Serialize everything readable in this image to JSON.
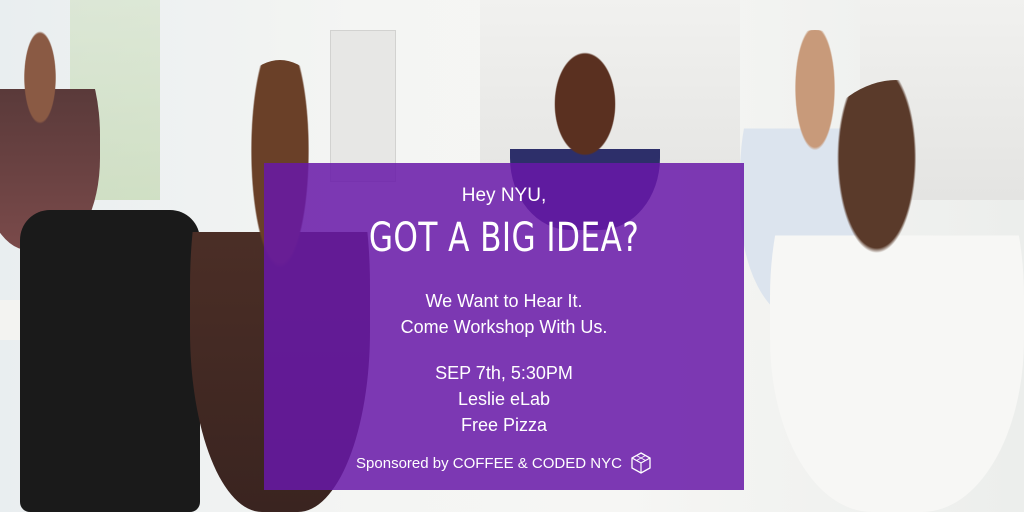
{
  "card": {
    "greeting": "Hey NYU,",
    "headline": "GOT A BIG IDEA?",
    "tagline_1": "We Want to Hear It.",
    "tagline_2": "Come Workshop With Us.",
    "datetime": "SEP 7th, 5:30PM",
    "location": "Leslie eLab",
    "perk": "Free Pizza",
    "sponsor_text": "Sponsored by COFFEE & CODED NYC",
    "sponsor_icon": "cube-logo-icon"
  },
  "colors": {
    "card_overlay": "#6818a8",
    "text": "#ffffff"
  }
}
